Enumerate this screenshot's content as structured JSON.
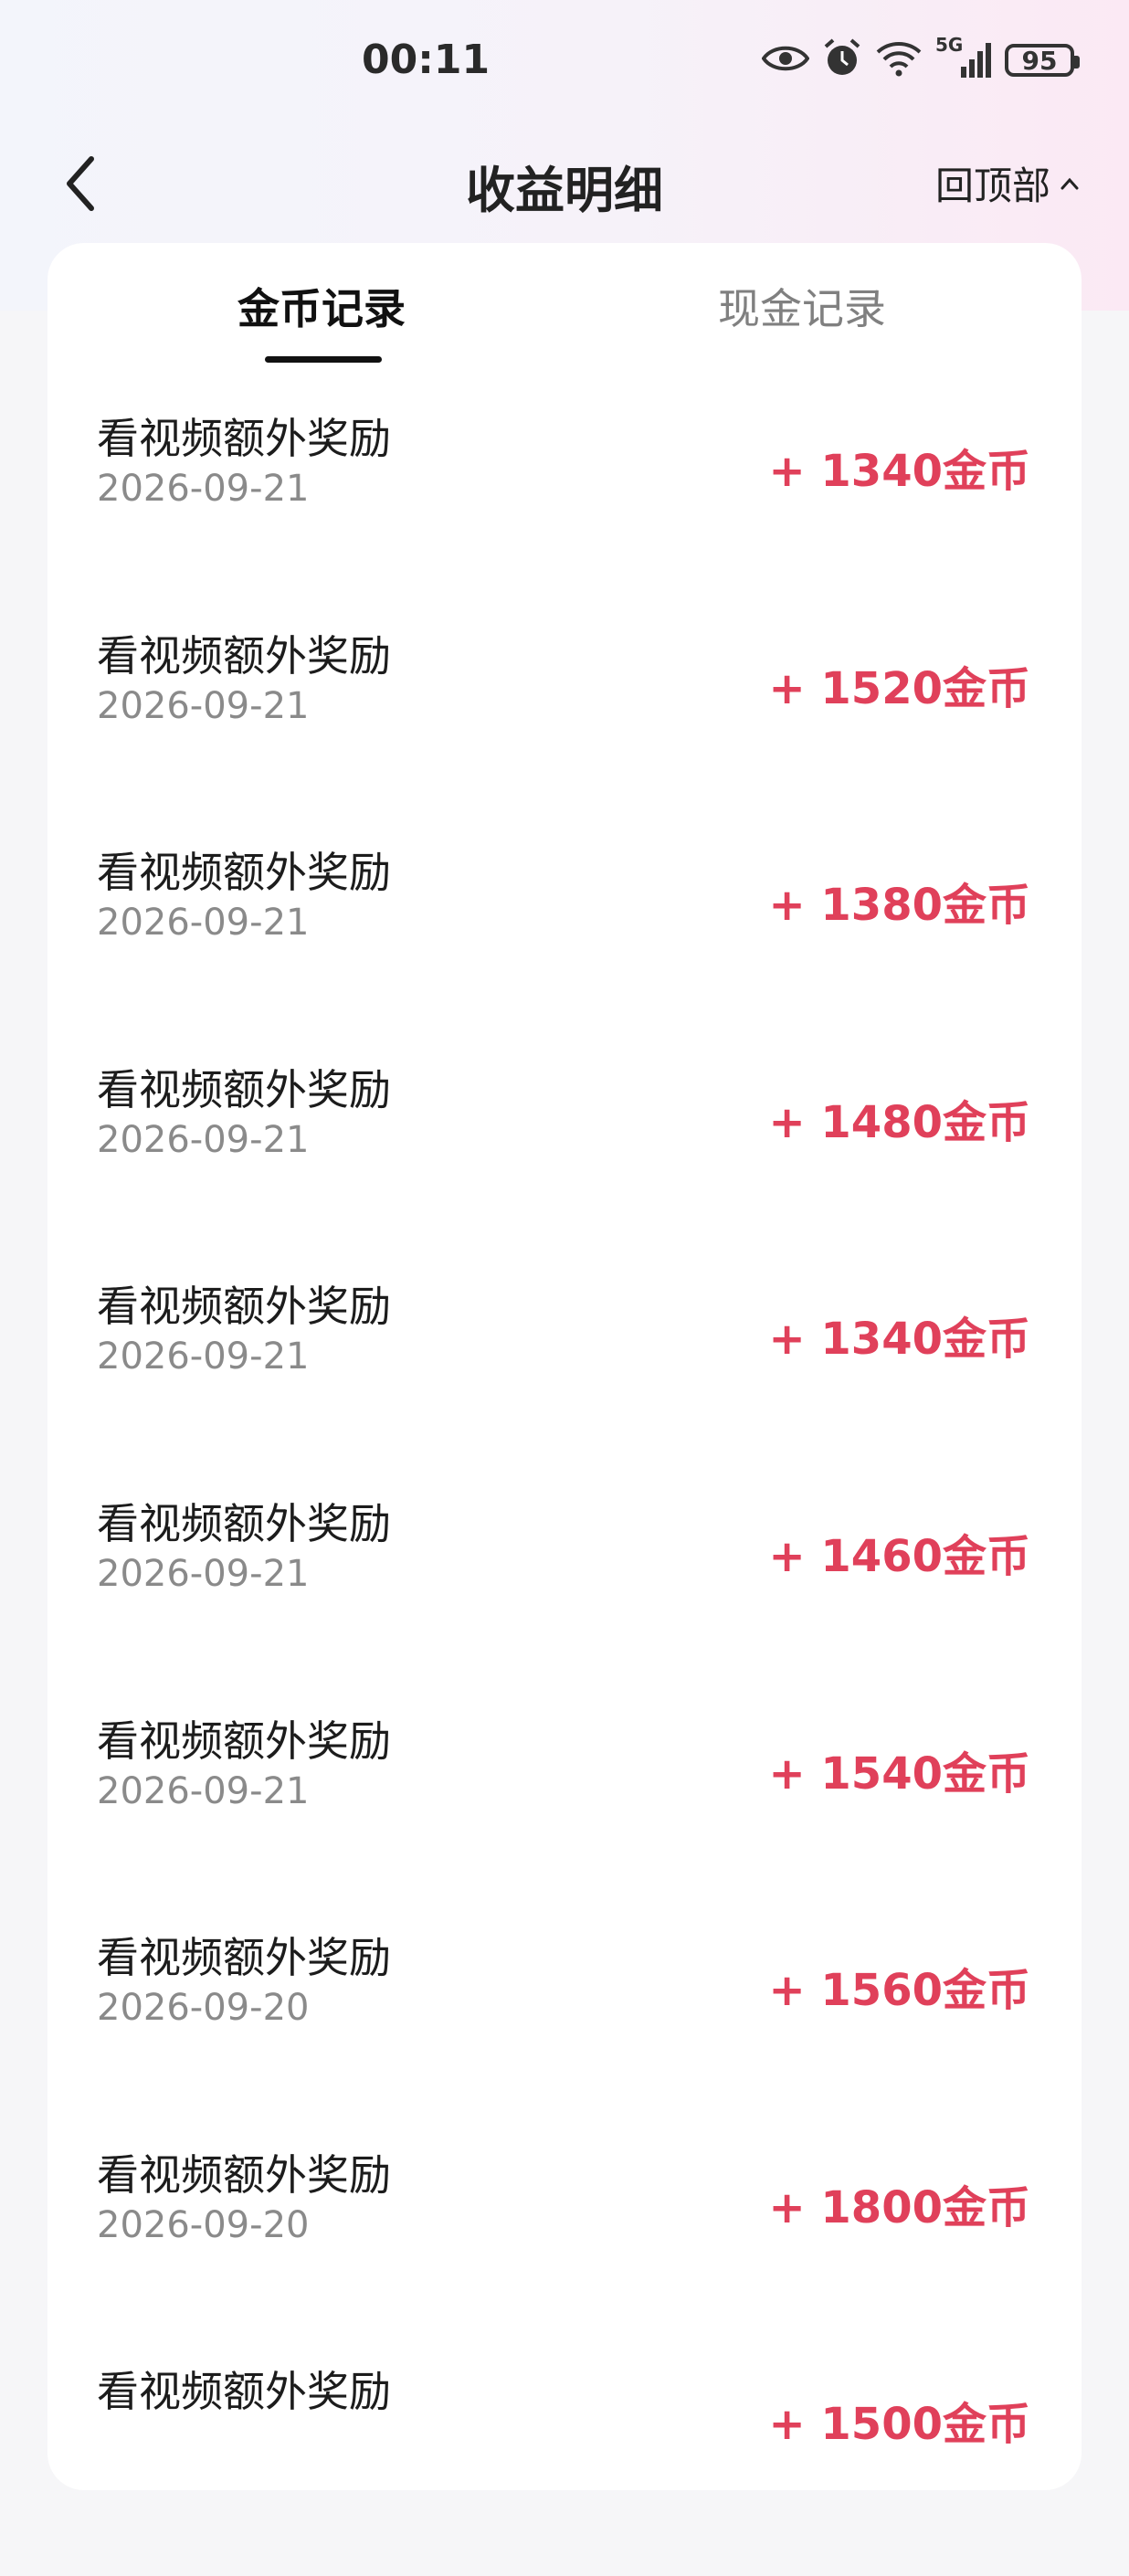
{
  "status_bar": {
    "time": "00:11",
    "network": "5G",
    "battery": "95",
    "icons": [
      "eye-icon",
      "alarm-icon",
      "wifi-icon",
      "signal-icon",
      "battery-icon"
    ]
  },
  "nav": {
    "title": "收益明细",
    "back_to_top": "回顶部",
    "back_icon": "chevron-left-icon",
    "up_icon": "chevron-up-icon"
  },
  "tabs": [
    {
      "label": "金币记录",
      "active": true
    },
    {
      "label": "现金记录",
      "active": false
    }
  ],
  "records": [
    {
      "title": "看视频额外奖励",
      "date": "2026-09-21",
      "amount": "+ 1340金币"
    },
    {
      "title": "看视频额外奖励",
      "date": "2026-09-21",
      "amount": "+ 1520金币"
    },
    {
      "title": "看视频额外奖励",
      "date": "2026-09-21",
      "amount": "+ 1380金币"
    },
    {
      "title": "看视频额外奖励",
      "date": "2026-09-21",
      "amount": "+ 1480金币"
    },
    {
      "title": "看视频额外奖励",
      "date": "2026-09-21",
      "amount": "+ 1340金币"
    },
    {
      "title": "看视频额外奖励",
      "date": "2026-09-21",
      "amount": "+ 1460金币"
    },
    {
      "title": "看视频额外奖励",
      "date": "2026-09-21",
      "amount": "+ 1540金币"
    },
    {
      "title": "看视频额外奖励",
      "date": "2026-09-20",
      "amount": "+ 1560金币"
    },
    {
      "title": "看视频额外奖励",
      "date": "2026-09-20",
      "amount": "+ 1800金币"
    },
    {
      "title": "看视频额外奖励",
      "date": "",
      "amount": "+ 1500金币"
    }
  ],
  "colors": {
    "amount": "#e0405a",
    "active_tab": "#111111",
    "inactive_tab": "#808080",
    "date": "#8a8a8a"
  }
}
